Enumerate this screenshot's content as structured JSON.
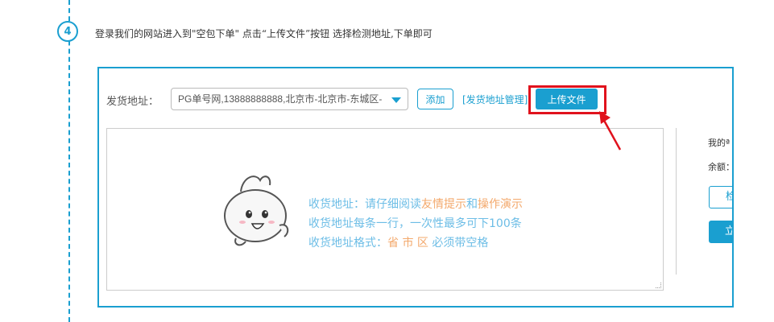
{
  "step": {
    "number": "4",
    "instruction": "登录我们的网站进入到\"空包下单\" 点击“上传文件”按钮 选择检测地址,下单即可"
  },
  "form": {
    "address_label": "发货地址：",
    "address_value": "PG单号网,13888888888,北京市-北京市-东城区-",
    "add_button": "添加",
    "manage_link": "[发货地址管理]",
    "upload_button": "上传文件"
  },
  "hints": {
    "line1_prefix": "收货地址：请仔细阅读",
    "line1_link1": "友情提示",
    "line1_mid": "和",
    "line1_link2": "操作演示",
    "line2": "收货地址每条一行，一次性最多可下100条",
    "line3_prefix": "收货地址格式：",
    "line3_highlight": "省 市 区",
    "line3_suffix": " 必须带空格"
  },
  "side": {
    "text1": "我的ª",
    "text2": "余额：",
    "button_outline": "检",
    "button_solid": "立"
  },
  "colors": {
    "accent": "#1a9fd0",
    "highlight_box": "#e0121d",
    "arrow": "#e0121d",
    "hint_blue": "#6cbde6",
    "hint_orange": "#f3a86b"
  }
}
